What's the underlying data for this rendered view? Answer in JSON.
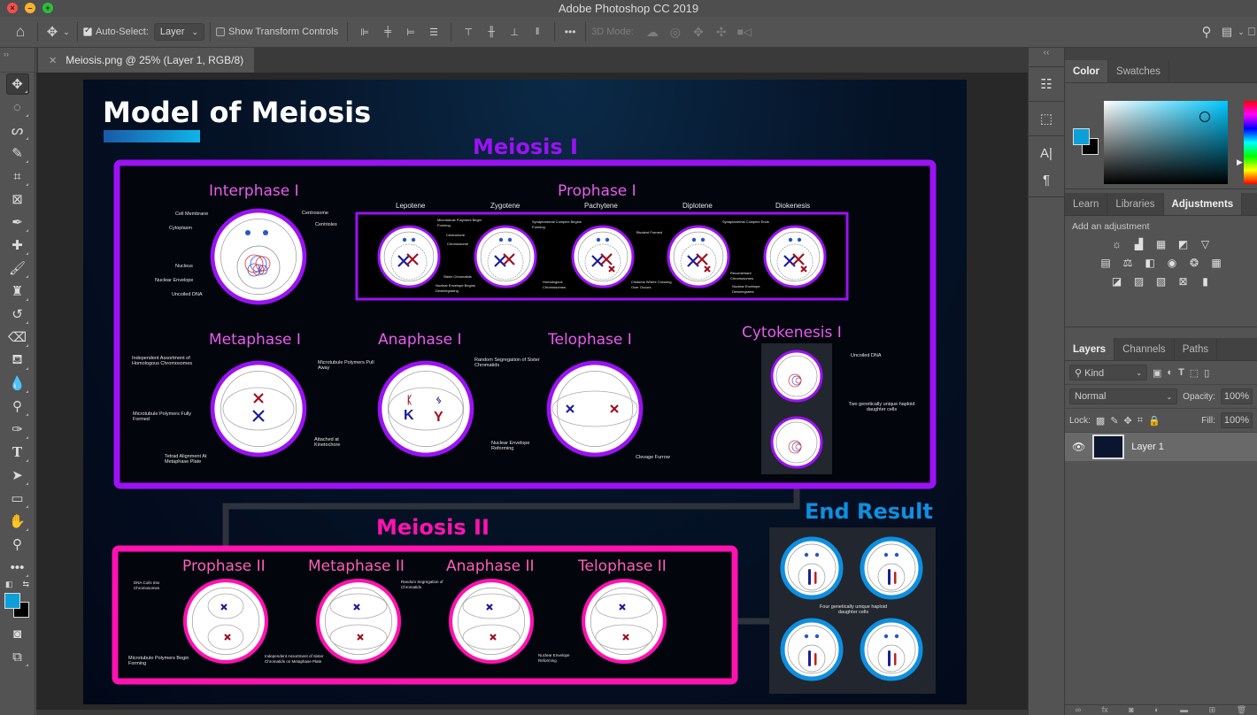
{
  "window": {
    "title": "Adobe Photoshop CC 2019"
  },
  "options_bar": {
    "auto_select_label": "Auto-Select:",
    "auto_select_checked": true,
    "auto_select_value": "Layer",
    "show_transform_label": "Show Transform Controls",
    "show_transform_checked": false,
    "mode_3d_label": "3D Mode:",
    "more_label": "•••"
  },
  "document": {
    "tab_label": "Meiosis.png @ 25% (Layer 1, RGB/8)",
    "zoom": "25%"
  },
  "tools": [
    "move",
    "marquee",
    "lasso",
    "quick-selection",
    "crop",
    "frame",
    "eyedropper",
    "healing-brush",
    "brush",
    "clone-stamp",
    "history-brush",
    "eraser",
    "paint-bucket",
    "blur",
    "dodge",
    "pen",
    "type",
    "path-selection",
    "rectangle",
    "hand",
    "zoom",
    "edit-toolbar"
  ],
  "colors": {
    "foreground": "#0da0d8",
    "background": "#000000",
    "meiosis1": "#9b12f5",
    "meiosis2": "#ff12b0",
    "end_result": "#0e8fe0",
    "stage_title": "#e85cf0"
  },
  "panels": {
    "color_tabs": [
      "Color",
      "Swatches"
    ],
    "color_active": "Color",
    "adjust_tabs": [
      "Learn",
      "Libraries",
      "Adjustments"
    ],
    "adjust_active": "Adjustments",
    "add_adjustment": "Add an adjustment",
    "layers_tabs": [
      "Layers",
      "Channels",
      "Paths"
    ],
    "layers_active": "Layers",
    "kind_label": "Kind",
    "blend_mode": "Normal",
    "opacity_label": "Opacity:",
    "opacity_value": "100%",
    "lock_label": "Lock:",
    "fill_label": "Fill:",
    "fill_value": "100%",
    "layers": [
      {
        "name": "Layer 1",
        "visible": true
      }
    ]
  },
  "poster": {
    "title": "Model of Meiosis",
    "meiosis1_heading": "Meiosis I",
    "meiosis2_heading": "Meiosis II",
    "end_heading": "End Result",
    "interphase": {
      "title": "Interphase I",
      "labels": [
        "Cell Membrane",
        "Cytoplasm",
        "Nucleus",
        "Nuclear Envelope",
        "Uncoiled DNA",
        "Centrosome",
        "Centrioles"
      ]
    },
    "prophase1": {
      "title": "Prophase I",
      "substages": [
        "Lepotene",
        "Zygotene",
        "Pachytene",
        "Diplotene",
        "Diokenesis"
      ],
      "labels": [
        "Microtubule Polymers Begin Forming",
        "Centromere",
        "Chromosome",
        "Sister Chromatids",
        "Nuclear Envelope Begins Desintegrating",
        "Synaptonemal Complex Begins Forming",
        "Homologous Chromosomes",
        "Bivalent Formed",
        "Chiasma Where Crossing Over Occurs",
        "Synaptonemal Complex Ends",
        "Recombinant Chromosomes",
        "Nuclear Envelope Desintegrates"
      ]
    },
    "metaphase1": {
      "title": "Metaphase I",
      "labels": [
        "Independent Assortment of Homologous Chromosomes",
        "Microtubule Polymers Fully Formed",
        "Tetrad Alignment At Metaphase Plate",
        "Attached at Kinetochore"
      ]
    },
    "anaphase1": {
      "title": "Anaphase I",
      "labels": [
        "Microtubule Polymers Pull Away",
        "Random Segregation of Sister Chromatids"
      ]
    },
    "telophase1": {
      "title": "Telophase I",
      "labels": [
        "Nuclear Envelope Reforming",
        "Clevage Furrow"
      ]
    },
    "cytokinesis1": {
      "title": "Cytokenesis I",
      "labels": [
        "Uncoiled DNA",
        "Two genetically unique haploid daughter cells"
      ]
    },
    "prophase2": {
      "title": "Prophase II",
      "labels": [
        "DNA Coils Into Chromosomes",
        "Microtubule Polymers Begin Forming"
      ]
    },
    "metaphase2": {
      "title": "Metaphase II",
      "labels": [
        "Independent Assortment of Sister Chromatids on Metaphase Plate"
      ]
    },
    "anaphase2": {
      "title": "Anaphase II",
      "labels": [
        "Random Segregation of Chromatids"
      ]
    },
    "telophase2": {
      "title": "Telophase II",
      "labels": [
        "Nuclear Envelope Reforming"
      ]
    },
    "end_result": {
      "caption": "Four genetically unique haploid daughter cells"
    }
  }
}
